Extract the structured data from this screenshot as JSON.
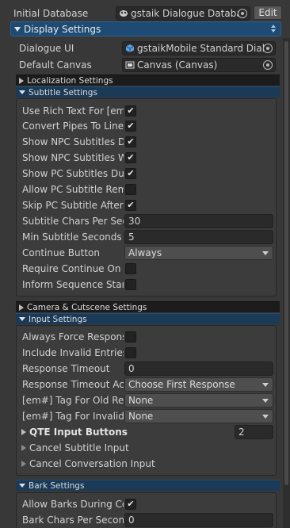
{
  "header": {
    "initial_database_label": "Initial Database",
    "initial_database_value": "gstaik Dialogue Databas",
    "edit_button": "Edit"
  },
  "display_settings": {
    "title": "Display Settings",
    "dialogue_ui_label": "Dialogue UI",
    "dialogue_ui_value": "gstaikMobile Standard Dialo",
    "default_canvas_label": "Default Canvas",
    "default_canvas_value": "Canvas (Canvas)"
  },
  "localization_settings": {
    "title": "Localization Settings"
  },
  "subtitle_settings": {
    "title": "Subtitle Settings",
    "use_rich_text_label": "Use Rich Text For [em#",
    "convert_pipes_label": "Convert Pipes To Line",
    "show_npc_subtitles_during_label": "Show NPC Subtitles Du",
    "show_npc_subtitles_with_label": "Show NPC Subtitles W",
    "show_pc_subtitles_label": "Show PC Subtitles Dur",
    "allow_pc_subtitle_label": "Allow PC Subtitle Remi",
    "skip_pc_subtitle_label": "Skip PC Subtitle After I",
    "chars_per_sec_label": "Subtitle Chars Per Sec",
    "chars_per_sec_value": "30",
    "min_seconds_label": "Min Subtitle Seconds",
    "min_seconds_value": "5",
    "continue_button_label": "Continue Button",
    "continue_button_value": "Always",
    "require_continue_label": "Require Continue On L",
    "inform_sequence_label": "Inform Sequence Start"
  },
  "camera_settings": {
    "title": "Camera & Cutscene Settings"
  },
  "input_settings": {
    "title": "Input Settings",
    "always_force_label": "Always Force Respons",
    "include_invalid_label": "Include Invalid Entries",
    "response_timeout_label": "Response Timeout",
    "response_timeout_value": "0",
    "response_timeout_action_label": "Response Timeout Act",
    "response_timeout_action_value": "Choose First Response",
    "tag_old_label": "[em#] Tag For Old Res",
    "tag_old_value": "None",
    "tag_invalid_label": "[em#] Tag For Invalid R",
    "tag_invalid_value": "None",
    "qte_label": "QTE Input Buttons",
    "qte_value": "2",
    "cancel_subtitle_label": "Cancel Subtitle Input",
    "cancel_conversation_label": "Cancel Conversation Input"
  },
  "bark_settings": {
    "title": "Bark Settings",
    "allow_barks_label": "Allow Barks During Co",
    "bark_chars_label": "Bark Chars Per Second",
    "bark_chars_value": "0"
  },
  "colors": {
    "background": "#383838",
    "foldout_main": "#1f4b72",
    "foldout_open_sub": "#1a3a58",
    "field": "#2a2a2a"
  }
}
